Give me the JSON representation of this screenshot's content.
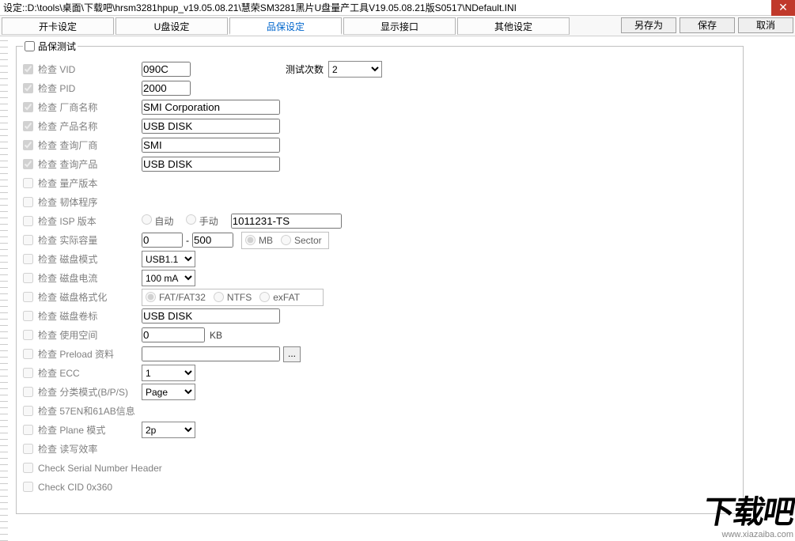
{
  "window": {
    "title": "设定::D:\\tools\\桌面\\下载吧\\hrsm3281hpup_v19.05.08.21\\慧荣SM3281黑片U盘量产工具V19.05.08.21版S0517\\NDefault.INI",
    "close": "✕"
  },
  "tabs": {
    "t0": "开卡设定",
    "t1": "U盘设定",
    "t2": "品保设定",
    "t3": "显示接口",
    "t4": "其他设定"
  },
  "buttons": {
    "saveas": "另存为",
    "save": "保存",
    "cancel": "取消"
  },
  "qa": {
    "legend": "品保测试",
    "testcount_label": "测试次数",
    "testcount_value": "2",
    "rows": {
      "vid": {
        "label": "检查 VID",
        "value": "090C"
      },
      "pid": {
        "label": "检查 PID",
        "value": "2000"
      },
      "vendor": {
        "label": "检查 厂商名称",
        "value": "SMI Corporation"
      },
      "product": {
        "label": "检查 产品名称",
        "value": "USB DISK"
      },
      "qvendor": {
        "label": "检查 查询厂商",
        "value": "SMI"
      },
      "qproduct": {
        "label": "检查 查询产品",
        "value": "USB DISK"
      },
      "mpver": {
        "label": "检查 量产版本"
      },
      "fwprog": {
        "label": "检查 韧体程序"
      },
      "ispver": {
        "label": "检查 ISP 版本",
        "auto": "自动",
        "manual": "手动",
        "value": "1011231-TS"
      },
      "capacity": {
        "label": "检查 实际容量",
        "from": "0",
        "to": "500",
        "mb": "MB",
        "sector": "Sector"
      },
      "diskmode": {
        "label": "检查 磁盘模式",
        "value": "USB1.1"
      },
      "diskcur": {
        "label": "检查 磁盘电流",
        "value": "100 mA"
      },
      "diskfmt": {
        "label": "检查 磁盘格式化",
        "opt1": "FAT/FAT32",
        "opt2": "NTFS",
        "opt3": "exFAT"
      },
      "vol": {
        "label": "检查 磁盘卷标",
        "value": "USB DISK"
      },
      "used": {
        "label": "检查 使用空间",
        "value": "0",
        "unit": "KB"
      },
      "preload": {
        "label": "检查 Preload 资料",
        "value": "",
        "browse": "..."
      },
      "ecc": {
        "label": "检查 ECC",
        "value": "1"
      },
      "class": {
        "label": "检查 分类模式(B/P/S)",
        "value": "Page"
      },
      "en61ab": {
        "label": "检查 57EN和61AB信息"
      },
      "plane": {
        "label": "检查 Plane 模式",
        "value": "2p"
      },
      "rweff": {
        "label": "检查 读写效率"
      },
      "snhdr": {
        "label": "Check Serial Number Header"
      },
      "cid": {
        "label": "Check CID 0x360"
      }
    }
  },
  "watermark": {
    "big": "下载吧",
    "url": "www.xiazaiba.com"
  }
}
